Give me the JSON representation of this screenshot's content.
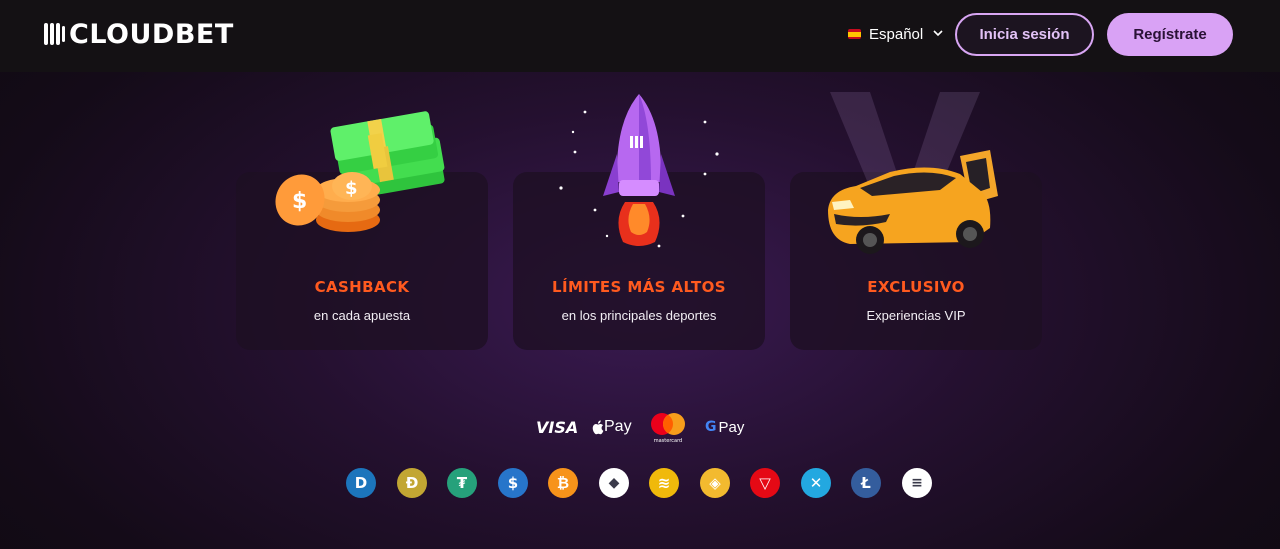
{
  "header": {
    "logo_text": "CLOUDBET",
    "language": "Español",
    "login_label": "Inicia sesión",
    "register_label": "Regístrate"
  },
  "cards": [
    {
      "title": "CASHBACK",
      "subtitle": "en cada apuesta",
      "art": "money-coins-illustration"
    },
    {
      "title": "LÍMITES MÁS ALTOS",
      "subtitle": "en los principales deportes",
      "art": "rocket-illustration"
    },
    {
      "title": "EXCLUSIVO",
      "subtitle": "Experiencias VIP",
      "art": "sports-car-illustration"
    }
  ],
  "payments": {
    "visa": "VISA",
    "apple_pay": "Pay",
    "mastercard": "mastercard",
    "google_pay": "Pay"
  },
  "crypto": [
    {
      "name": "dash-icon",
      "glyph": "D",
      "color": "#1c75bc"
    },
    {
      "name": "dogecoin-icon",
      "glyph": "Ð",
      "color": "#c2a633"
    },
    {
      "name": "tether-icon",
      "glyph": "₮",
      "color": "#26a17b"
    },
    {
      "name": "usdc-icon",
      "glyph": "$",
      "color": "#2775ca"
    },
    {
      "name": "bitcoin-icon",
      "glyph": "₿",
      "color": "#f7931a"
    },
    {
      "name": "ethereum-icon",
      "glyph": "◆",
      "color": "#ffffff"
    },
    {
      "name": "binance-usd-icon",
      "glyph": "≋",
      "color": "#f0b90b"
    },
    {
      "name": "bnb-icon",
      "glyph": "◈",
      "color": "#f3ba2f"
    },
    {
      "name": "tron-icon",
      "glyph": "▽",
      "color": "#e50915"
    },
    {
      "name": "xrp-icon",
      "glyph": "✕",
      "color": "#23a8e0"
    },
    {
      "name": "litecoin-icon",
      "glyph": "Ł",
      "color": "#345d9d"
    },
    {
      "name": "solana-icon",
      "glyph": "≡",
      "color": "#ffffff"
    }
  ]
}
